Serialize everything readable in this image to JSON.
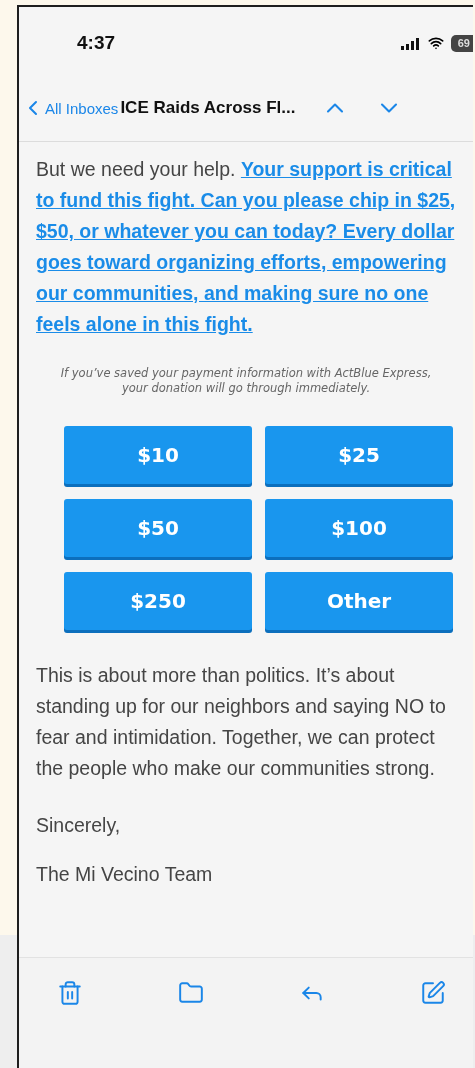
{
  "status_bar": {
    "time": "4:37",
    "battery": "69"
  },
  "nav": {
    "back": "All Inboxes",
    "title": "ICE Raids Across Fl..."
  },
  "message": {
    "appeal": {
      "intro": "But we need your help. ",
      "link": "Your support is critical to fund this fight. Can you please chip in $25, $50, or whatever you can today? Every dollar goes toward organizing efforts, empowering our communities, and making sure no one feels alone in this fight."
    },
    "note_lines": [
      "If you’ve saved your payment information with ActBlue Express,",
      "your donation will go through immediately."
    ],
    "amounts": [
      "$10",
      "$25",
      "$50",
      "$100",
      "$250",
      "Other"
    ],
    "closing": "This is about more than politics. It’s about standing up for our neighbors and saying NO to fear and intimidation. Together, we can protect the people who make our communities strong.",
    "sign_off": "Sincerely,",
    "signature": "The Mi Vecino Team"
  },
  "toolbar": [
    {
      "kind": "trash"
    },
    {
      "kind": "folder"
    },
    {
      "kind": "reply"
    },
    {
      "kind": "compose"
    }
  ]
}
